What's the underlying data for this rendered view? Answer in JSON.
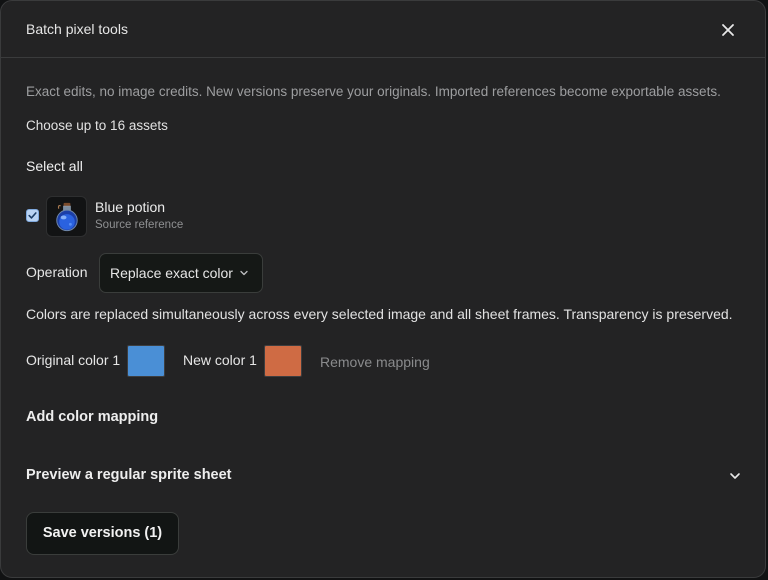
{
  "dialog": {
    "title": "Batch pixel tools",
    "description": "Exact edits, no image credits. New versions preserve your originals. Imported references become exportable assets.",
    "limit_text": "Choose up to 16 assets",
    "select_all_label": "Select all",
    "close_icon": "close-icon"
  },
  "assets": [
    {
      "name": "Blue potion",
      "subtitle": "Source reference",
      "checked": true,
      "icon": "potion-icon"
    }
  ],
  "operation": {
    "label": "Operation",
    "selected": "Replace exact color",
    "note": "Colors are replaced simultaneously across every selected image and all sheet frames. Transparency is preserved."
  },
  "mappings": [
    {
      "original_label": "Original color 1",
      "original_color": "#4a8fd6",
      "new_label": "New color 1",
      "new_color": "#cf6b44",
      "remove_label": "Remove mapping"
    }
  ],
  "add_mapping_label": "Add color mapping",
  "preview_label": "Preview a regular sprite sheet",
  "save_label": "Save versions (1)",
  "colors": {
    "background": "#232324",
    "checkbox": "#b9d3f3"
  }
}
